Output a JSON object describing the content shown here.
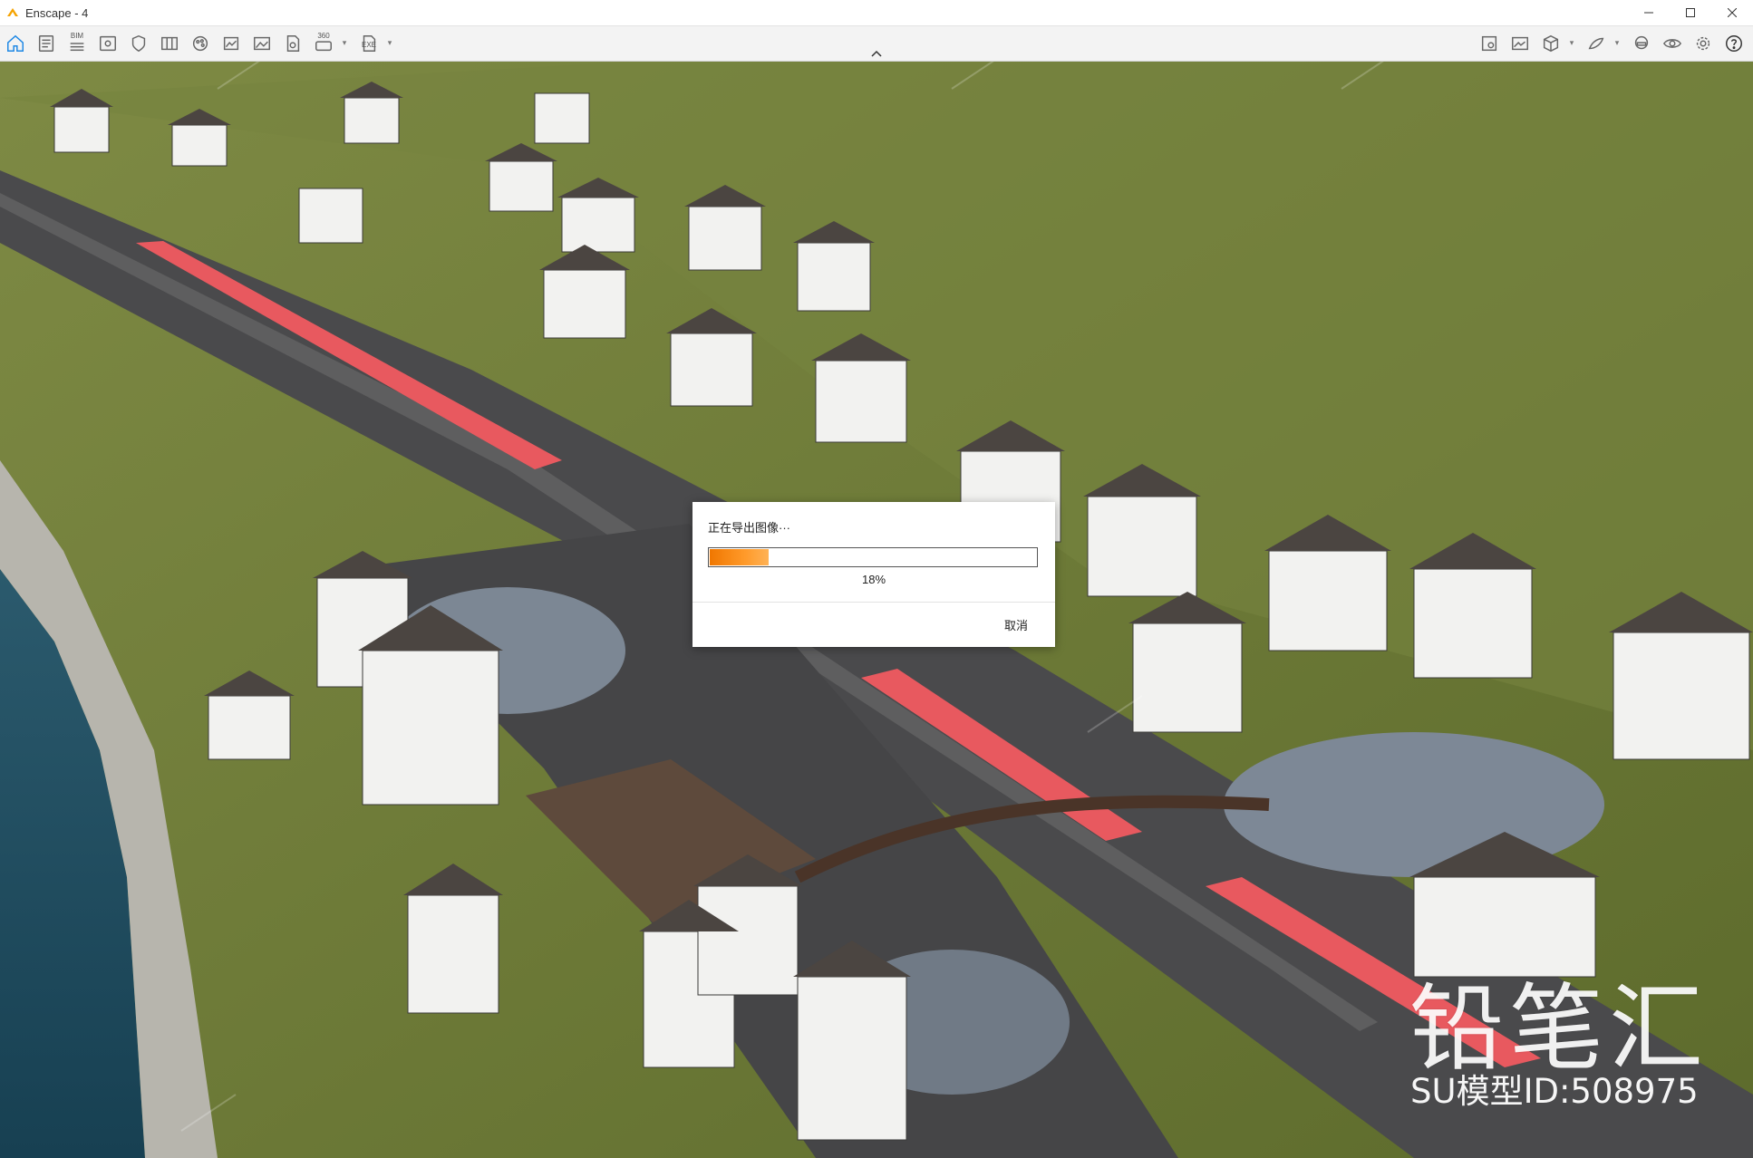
{
  "window": {
    "title": "Enscape - 4",
    "controls": [
      "minimize",
      "maximize",
      "close"
    ]
  },
  "toolbar": {
    "left_icons": [
      "home-icon",
      "list-icon",
      "bim-icon",
      "view-icon",
      "asset-icon",
      "sheets-icon",
      "material-icon",
      "screenshot-icon",
      "image-icon",
      "export-icon",
      "panorama-360-icon",
      "exe-icon"
    ],
    "labels": {
      "bim": "BIM",
      "pano": "360",
      "exe": "EXE"
    },
    "right_icons": [
      "asset-library-icon",
      "gallery-icon",
      "cube-icon",
      "batch-render-icon",
      "vr-headset-icon",
      "visual-settings-icon",
      "settings-icon",
      "help-icon"
    ]
  },
  "dialog": {
    "message": "正在导出图像···",
    "progress_percent": 18,
    "progress_text": "18%",
    "cancel_label": "取消",
    "progress_color": "#f07700"
  },
  "watermark": {
    "brand": "铅笔汇",
    "model_id": "SU模型ID:508975"
  }
}
